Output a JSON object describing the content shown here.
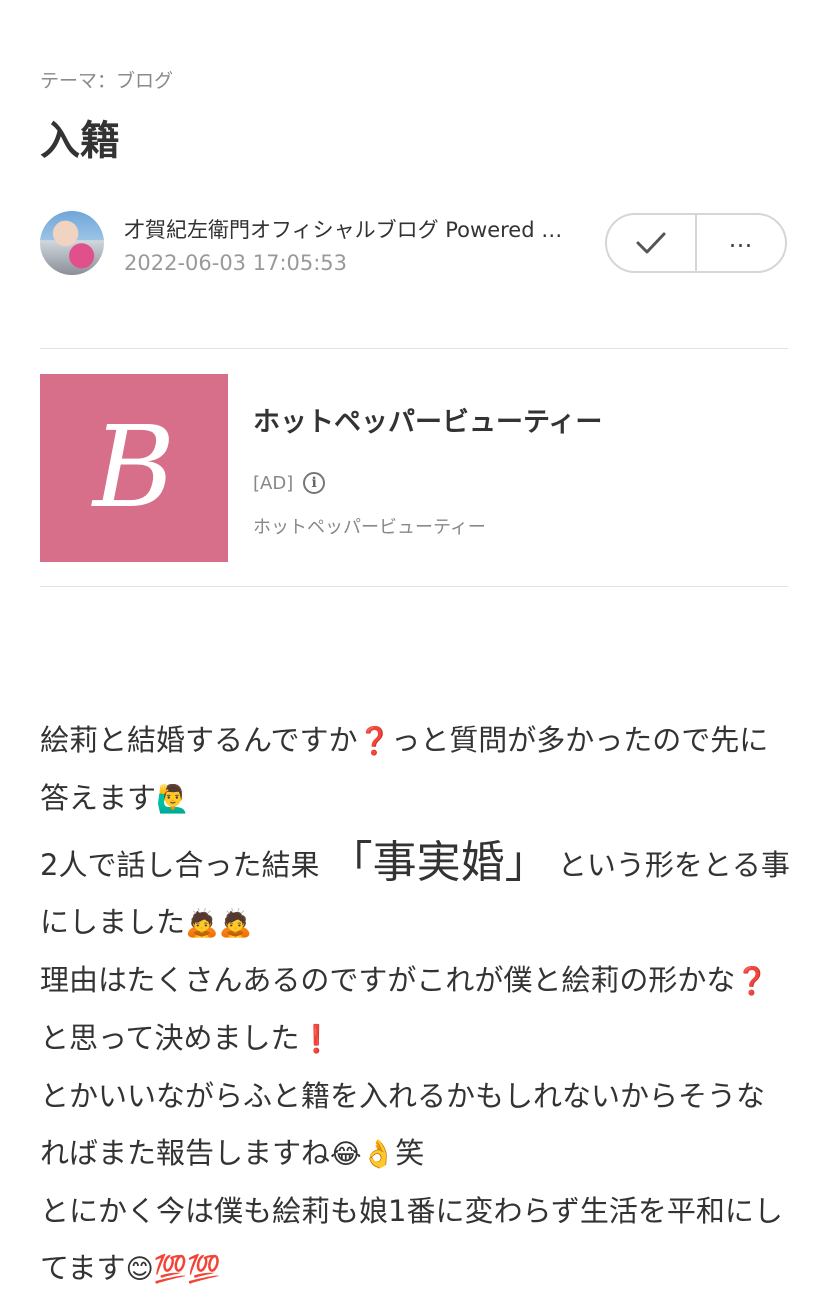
{
  "header": {
    "theme": "テーマ：ブログ",
    "title": "入籍"
  },
  "author": {
    "name": "才賀紀左衛門オフィシャルブログ Powered by Ameba",
    "date": "2022-06-03 17:05:53",
    "follow_icon": "check-icon",
    "more_label": "…"
  },
  "ad": {
    "title": "ホットペッパービューティー",
    "tag": "[AD]",
    "sponsor": "ホットペッパービューティー",
    "logo_letter": "B",
    "logo_color": "#d76e8a"
  },
  "article": {
    "p1a": "絵莉と結婚するんですか",
    "q1": "❓",
    "p1b": "っと質問が多かったので先に答えます",
    "e1": "🙋‍♂️",
    "p2a": "2人で話し合った結果",
    "p2big": "「事実婚」",
    "p2b": "という形をとる事にしました",
    "e2": "🙇🙇",
    "p3a": "理由はたくさんあるのですがこれが僕と絵莉の形かな",
    "q2": "❓",
    "p3b": "と思って決めました",
    "ex1": "❗",
    "p4a": "とかいいながらふと籍を入れるかもしれないからそうなればまた報告しますね",
    "e3": "😂👌",
    "p4b": "笑",
    "p5a": "とにかく今は僕も絵莉も娘1番に変わらず生活を平和にしてます",
    "e4": "😊💯💯"
  }
}
